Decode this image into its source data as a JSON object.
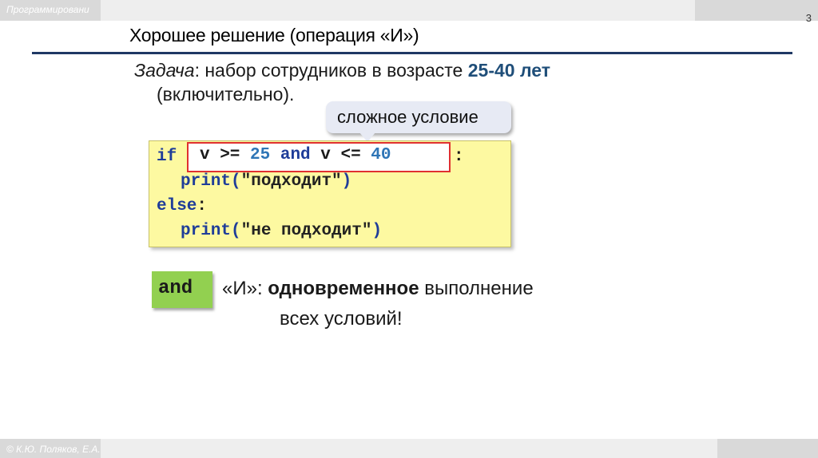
{
  "header": {
    "course_title": "Программировани",
    "page_number": "3"
  },
  "slide": {
    "title": "Хорошее решение (операция «И»)"
  },
  "task": {
    "label": "Задача",
    "text": ": набор сотрудников в возрасте ",
    "range": "25-40 лет",
    "continuation": "(включительно)."
  },
  "callout": {
    "text": "сложное условие"
  },
  "code": {
    "kw_if": "if",
    "cond_v1": "v >= ",
    "num_25": "25",
    "kw_and": "and",
    "cond_v2": " v <= ",
    "num_40": "40",
    "colon": ":",
    "print1_fn": "print(",
    "print1_str": "\"подходит\"",
    "print1_close": ")",
    "kw_else": "else",
    "else_colon": ":",
    "print2_fn": "print(",
    "print2_str": "\"не подходит\"",
    "print2_close": ")"
  },
  "definition": {
    "chip": "and",
    "quote": "«И»: ",
    "bold_word": "одновременное",
    "rest": " выполнение",
    "line2": "всех условий!"
  },
  "footer": {
    "copyright": "© К.Ю. Поляков, Е.А."
  }
}
